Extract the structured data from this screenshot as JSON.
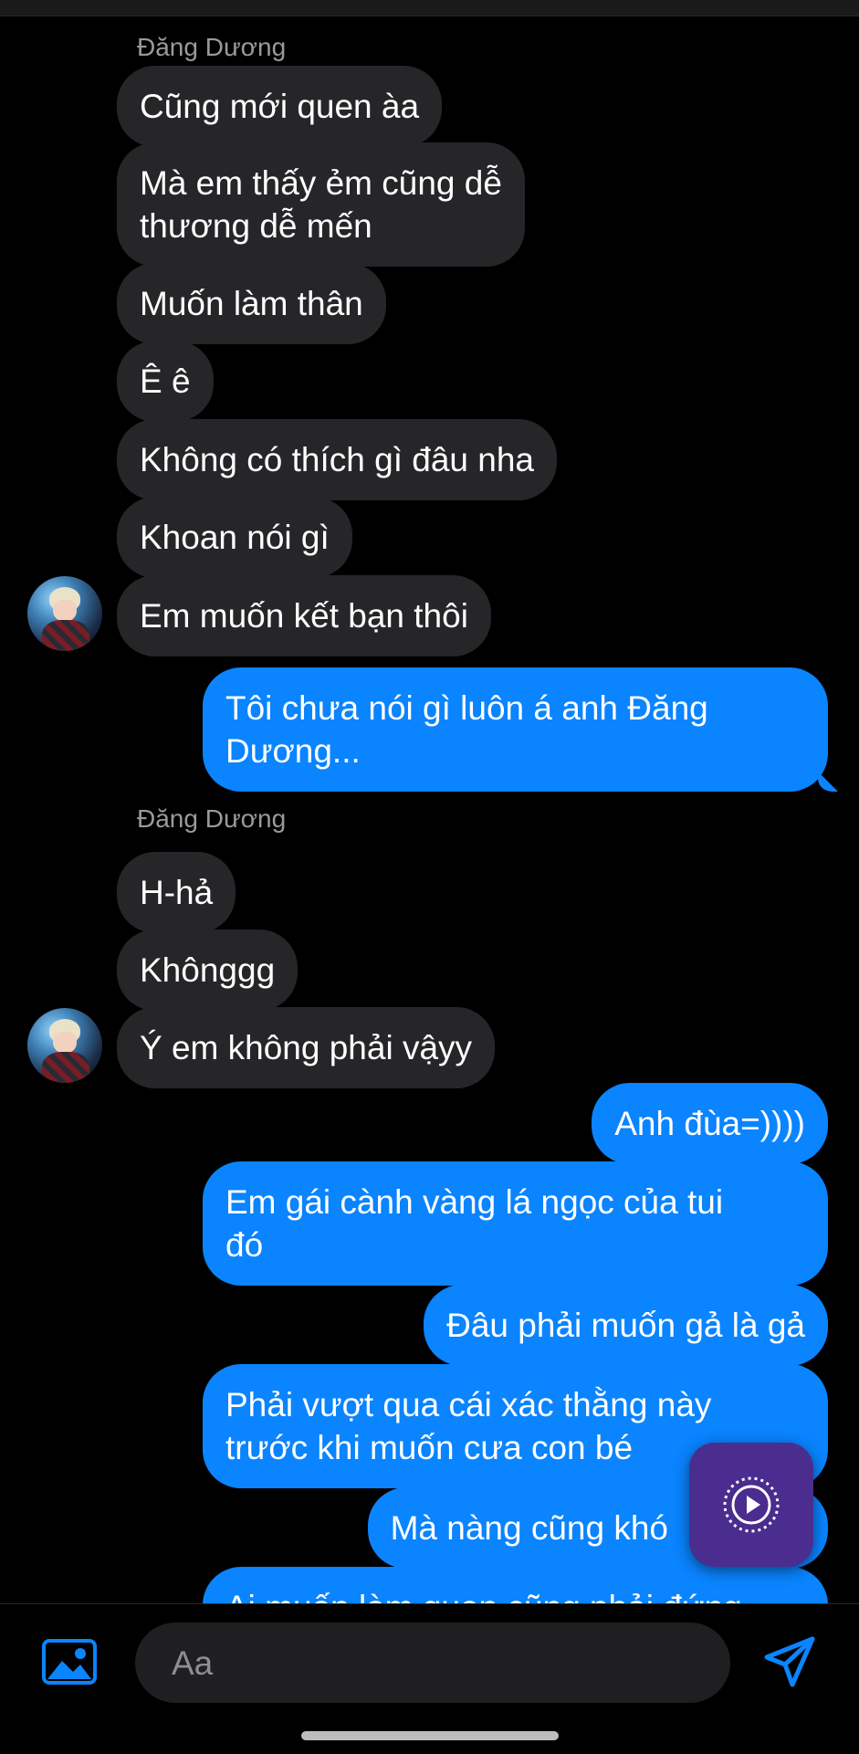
{
  "colors": {
    "background": "#000000",
    "incoming_bubble": "#262629",
    "outgoing_bubble": "#0a84ff",
    "accent": "#0a84ff",
    "sender_name": "#9a9a9a",
    "play_button": "#4a2d8f"
  },
  "chat": {
    "groups": [
      {
        "sender": "Đăng Dương",
        "messages": [
          "Cũng mới quen àa",
          "Mà em thấy ẻm cũng dễ\nthương dễ mến",
          "Muốn làm thân",
          "Ê ê",
          "Không có thích gì đâu nha",
          "Khoan nói gì",
          "Em muốn kết bạn thôi"
        ]
      },
      {
        "sender": "me",
        "messages": [
          "Tôi chưa nói gì luôn á anh Đăng\nDương..."
        ]
      },
      {
        "sender": "Đăng Dương",
        "messages": [
          "H-hả",
          "Khônggg",
          "Ý em không phải vậyy"
        ]
      },
      {
        "sender": "me",
        "messages": [
          "Anh đùa=))))",
          "Em gái cành vàng lá ngọc của tui\nđó",
          "Đâu phải muốn gả là gả",
          "Phải vượt qua cái xác thằng này\ntrước khi muốn cưa con bé",
          "Mà nàng cũng khó",
          "Ai muốn làm quen cũng phải đứng"
        ]
      }
    ]
  },
  "icons": {
    "avatar": "profile-picture",
    "play": "play-circle-icon",
    "image": "image-icon",
    "send": "send-icon"
  },
  "composer": {
    "placeholder": "Aa",
    "value": ""
  }
}
